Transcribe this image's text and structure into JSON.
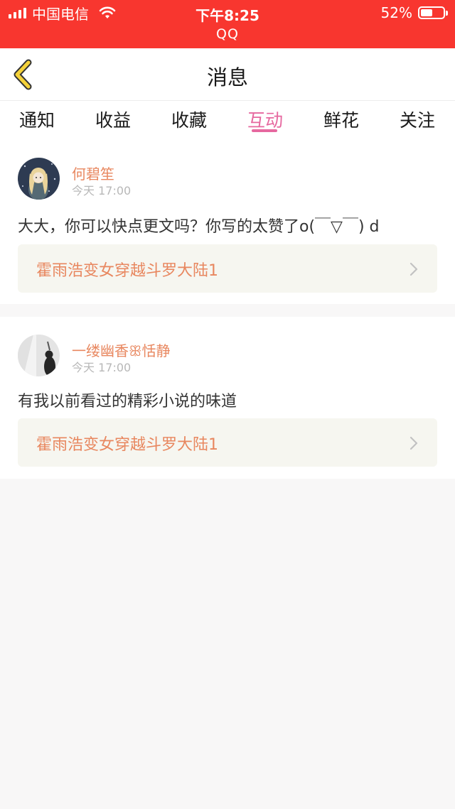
{
  "status_bar": {
    "carrier": "中国电信",
    "time": "下午8:25",
    "app": "QQ",
    "battery_text": "52%",
    "battery_level": 0.52
  },
  "header": {
    "title": "消息"
  },
  "tabs": [
    {
      "label": "通知",
      "active": false
    },
    {
      "label": "收益",
      "active": false
    },
    {
      "label": "收藏",
      "active": false
    },
    {
      "label": "互动",
      "active": true
    },
    {
      "label": "鲜花",
      "active": false
    },
    {
      "label": "关注",
      "active": false
    }
  ],
  "messages": [
    {
      "username": "何碧笙",
      "time": "今天 17:00",
      "content": "大大，你可以快点更文吗？你写的太赞了o(￣▽￣) d",
      "book_title": "霍雨浩变女穿越斗罗大陆1"
    },
    {
      "username": "一缕幽香ꕥ恬静",
      "time": "今天 17:00",
      "content": "有我以前看过的精彩小说的味道",
      "book_title": "霍雨浩变女穿越斗罗大陆1"
    }
  ],
  "colors": {
    "status_bar": "#f8362f",
    "accent_pink": "#e6689f",
    "username_orange": "#e8875f",
    "back_arrow_yellow": "#f5d23a",
    "background": "#f8f7f7"
  },
  "icons": {
    "back": "chevron-left-icon",
    "link": "chevron-right-icon",
    "wifi": "wifi-icon",
    "signal": "signal-icon",
    "battery": "battery-icon"
  }
}
